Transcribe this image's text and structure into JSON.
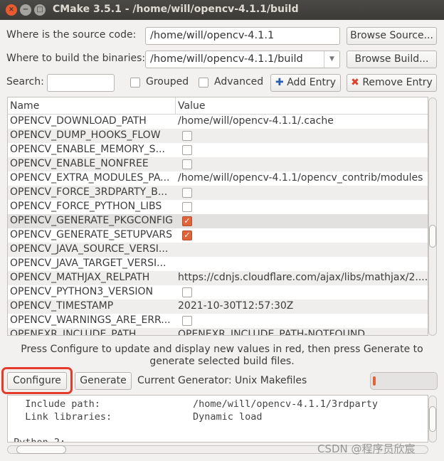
{
  "window": {
    "title": "CMake 3.5.1 - /home/will/opencv-4.1.1/build"
  },
  "source": {
    "label": "Where is the source code:",
    "value": "/home/will/opencv-4.1.1",
    "browse": "Browse Source..."
  },
  "build": {
    "label": "Where to build the binaries:",
    "value": "/home/will/opencv-4.1.1/build",
    "browse": "Browse Build..."
  },
  "search": {
    "label": "Search:",
    "value": ""
  },
  "options": {
    "grouped": "Grouped",
    "advanced": "Advanced",
    "add_entry": "Add Entry",
    "remove_entry": "Remove Entry"
  },
  "table": {
    "headers": [
      "Name",
      "Value"
    ],
    "rows": [
      {
        "name": "OPENCV_DOWNLOAD_PATH",
        "value": "/home/will/opencv-4.1.1/.cache"
      },
      {
        "name": "OPENCV_DUMP_HOOKS_FLOW",
        "check": false
      },
      {
        "name": "OPENCV_ENABLE_MEMORY_S...",
        "check": false
      },
      {
        "name": "OPENCV_ENABLE_NONFREE",
        "check": false
      },
      {
        "name": "OPENCV_EXTRA_MODULES_PA...",
        "value": "/home/will/opencv-4.1.1/opencv_contrib/modules"
      },
      {
        "name": "OPENCV_FORCE_3RDPARTY_B...",
        "check": false
      },
      {
        "name": "OPENCV_FORCE_PYTHON_LIBS",
        "check": false
      },
      {
        "name": "OPENCV_GENERATE_PKGCONFIG",
        "check": true
      },
      {
        "name": "OPENCV_GENERATE_SETUPVARS",
        "check": true
      },
      {
        "name": "OPENCV_JAVA_SOURCE_VERSI...",
        "value": ""
      },
      {
        "name": "OPENCV_JAVA_TARGET_VERSI...",
        "value": ""
      },
      {
        "name": "OPENCV_MATHJAX_RELPATH",
        "value": "https://cdnjs.cloudflare.com/ajax/libs/mathjax/2...."
      },
      {
        "name": "OPENCV_PYTHON3_VERSION",
        "check": false
      },
      {
        "name": "OPENCV_TIMESTAMP",
        "value": "2021-10-30T12:57:30Z"
      },
      {
        "name": "OPENCV_WARNINGS_ARE_ERR...",
        "check": false
      },
      {
        "name": "OPENEXR_INCLUDE_PATH",
        "value": "OPENEXR_INCLUDE_PATH-NOTFOUND"
      }
    ]
  },
  "hint": "Press Configure to update and display new values in red, then press Generate to generate selected build files.",
  "actions": {
    "configure": "Configure",
    "generate": "Generate",
    "generator": "Current Generator: Unix Makefiles"
  },
  "progress": 0.02,
  "output": {
    "lines": [
      "  Include path:                /home/will/opencv-4.1.1/3rdparty",
      "  Link libraries:              Dynamic load",
      "",
      "Python 2:"
    ]
  },
  "watermark": "CSDN @程序员欣宸",
  "colors": {
    "titlebar": "#3c3b37",
    "highlight": "#e53b2a",
    "check": "#e0643a"
  }
}
